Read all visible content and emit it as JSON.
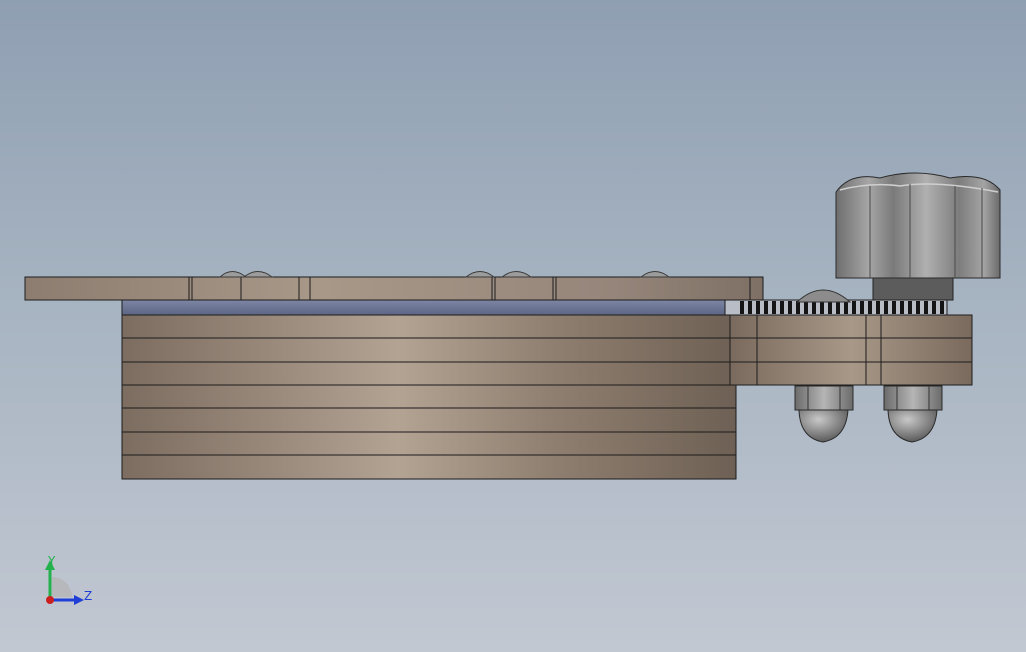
{
  "viewport": {
    "background_top": "#8f9fb2",
    "background_bottom": "#c2c8d2"
  },
  "model": {
    "material_color": "#a89a8c",
    "knob_color": "#9a9a9a",
    "nut_color": "#8e8e8e"
  },
  "triad": {
    "y_label": "Y",
    "z_label": "Z",
    "y_color": "#22b14c",
    "z_color": "#1f3fd6",
    "x_color": "#cc2020"
  }
}
